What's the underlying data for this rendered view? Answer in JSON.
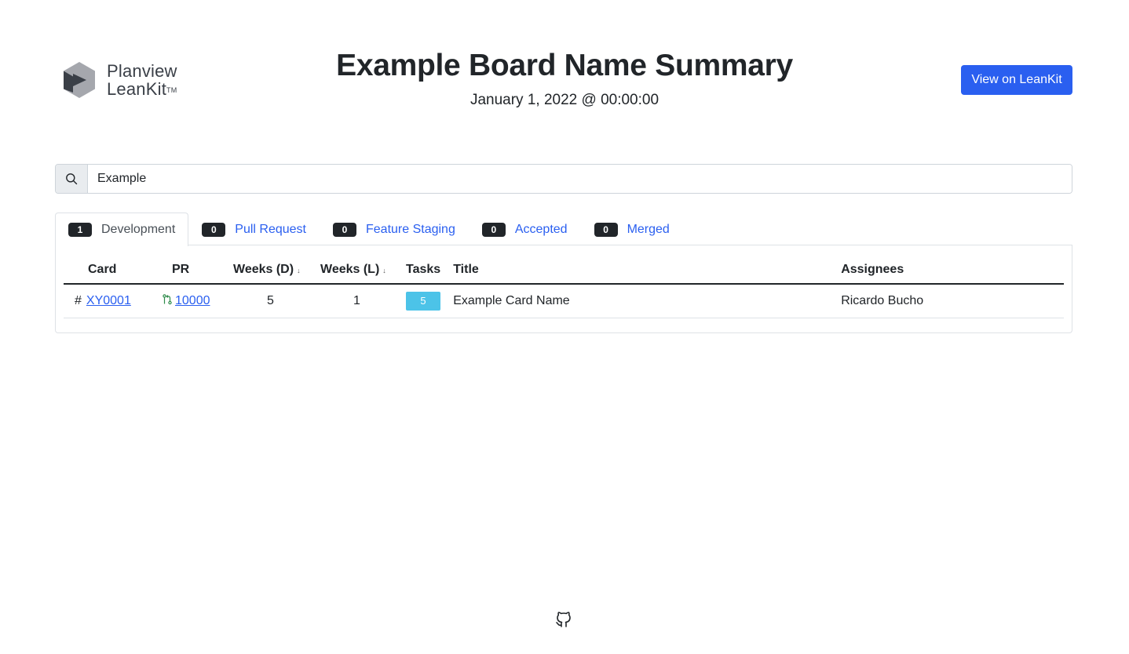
{
  "brand": {
    "line1": "Planview",
    "line2": "LeanKit",
    "tm": "TM",
    "colors": {
      "light": "#a5a7ad",
      "dark": "#3a3f47"
    }
  },
  "header": {
    "title": "Example Board Name Summary",
    "date": "January 1, 2022 @ 00:00:00",
    "view_button": "View on LeanKit"
  },
  "search": {
    "value": "Example",
    "icon": "search-icon"
  },
  "tabs": [
    {
      "count": "1",
      "label": "Development",
      "active": true
    },
    {
      "count": "0",
      "label": "Pull Request",
      "active": false
    },
    {
      "count": "0",
      "label": "Feature Staging",
      "active": false
    },
    {
      "count": "0",
      "label": "Accepted",
      "active": false
    },
    {
      "count": "0",
      "label": "Merged",
      "active": false
    }
  ],
  "table": {
    "columns": {
      "card": "Card",
      "pr": "PR",
      "weeks_d": "Weeks (D)",
      "weeks_l": "Weeks (L)",
      "tasks": "Tasks",
      "title": "Title",
      "assignees": "Assignees"
    },
    "rows": [
      {
        "hash": "#",
        "card": "XY0001",
        "pr_icon": "pull-request-icon",
        "pr": "10000",
        "weeks_d": "5",
        "weeks_l": "1",
        "tasks": "5",
        "title": "Example Card Name",
        "assignees": "Ricardo Bucho"
      }
    ]
  },
  "colors": {
    "primary": "#2a5ff0",
    "badge_dark": "#212529",
    "task_badge": "#4cc3e8",
    "pr_icon": "#2e8b4a"
  },
  "footer": {
    "icon": "github-icon"
  }
}
